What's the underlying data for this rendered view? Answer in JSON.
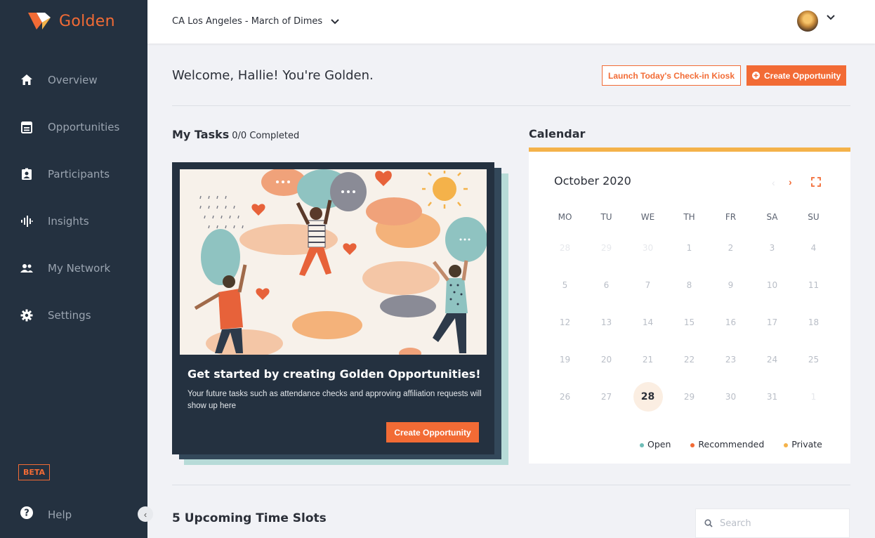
{
  "brand": {
    "name": "Golden",
    "accent": "#f26b35",
    "sidebar_bg": "#243140"
  },
  "sidebar": {
    "items": [
      {
        "label": "Overview",
        "icon": "home-icon"
      },
      {
        "label": "Opportunities",
        "icon": "calendar-note-icon"
      },
      {
        "label": "Participants",
        "icon": "badge-icon"
      },
      {
        "label": "Insights",
        "icon": "waveform-icon"
      },
      {
        "label": "My Network",
        "icon": "people-icon"
      },
      {
        "label": "Settings",
        "icon": "gear-icon"
      }
    ],
    "beta_label": "BETA",
    "help_label": "Help"
  },
  "topbar": {
    "org_name": "CA Los Angeles - March of Dimes"
  },
  "header": {
    "welcome": "Welcome, Hallie! You're Golden.",
    "kiosk_button": "Launch Today's Check-in Kiosk",
    "create_button": "Create Opportunity"
  },
  "tasks": {
    "title": "My Tasks",
    "count": "0/0 Completed",
    "card_title": "Get started by creating Golden Opportunities!",
    "card_desc": "Your future tasks such as attendance checks and approving affiliation requests will show up here",
    "card_button": "Create Opportunity"
  },
  "calendar": {
    "title": "Calendar",
    "month": "October 2020",
    "days": [
      "MO",
      "TU",
      "WE",
      "TH",
      "FR",
      "SA",
      "SU"
    ],
    "weeks": [
      [
        "28",
        "29",
        "30",
        "1",
        "2",
        "3",
        "4"
      ],
      [
        "5",
        "6",
        "7",
        "8",
        "9",
        "10",
        "11"
      ],
      [
        "12",
        "13",
        "14",
        "15",
        "16",
        "17",
        "18"
      ],
      [
        "19",
        "20",
        "21",
        "22",
        "23",
        "24",
        "25"
      ],
      [
        "26",
        "27",
        "28",
        "29",
        "30",
        "31",
        "1"
      ]
    ],
    "today": "28",
    "legend": [
      {
        "label": "Open",
        "color": "#6fbdb7"
      },
      {
        "label": "Recommended",
        "color": "#f26b35"
      },
      {
        "label": "Private",
        "color": "#f4b24a"
      }
    ]
  },
  "upcoming": {
    "title": "5 Upcoming Time Slots",
    "search_placeholder": "Search"
  }
}
